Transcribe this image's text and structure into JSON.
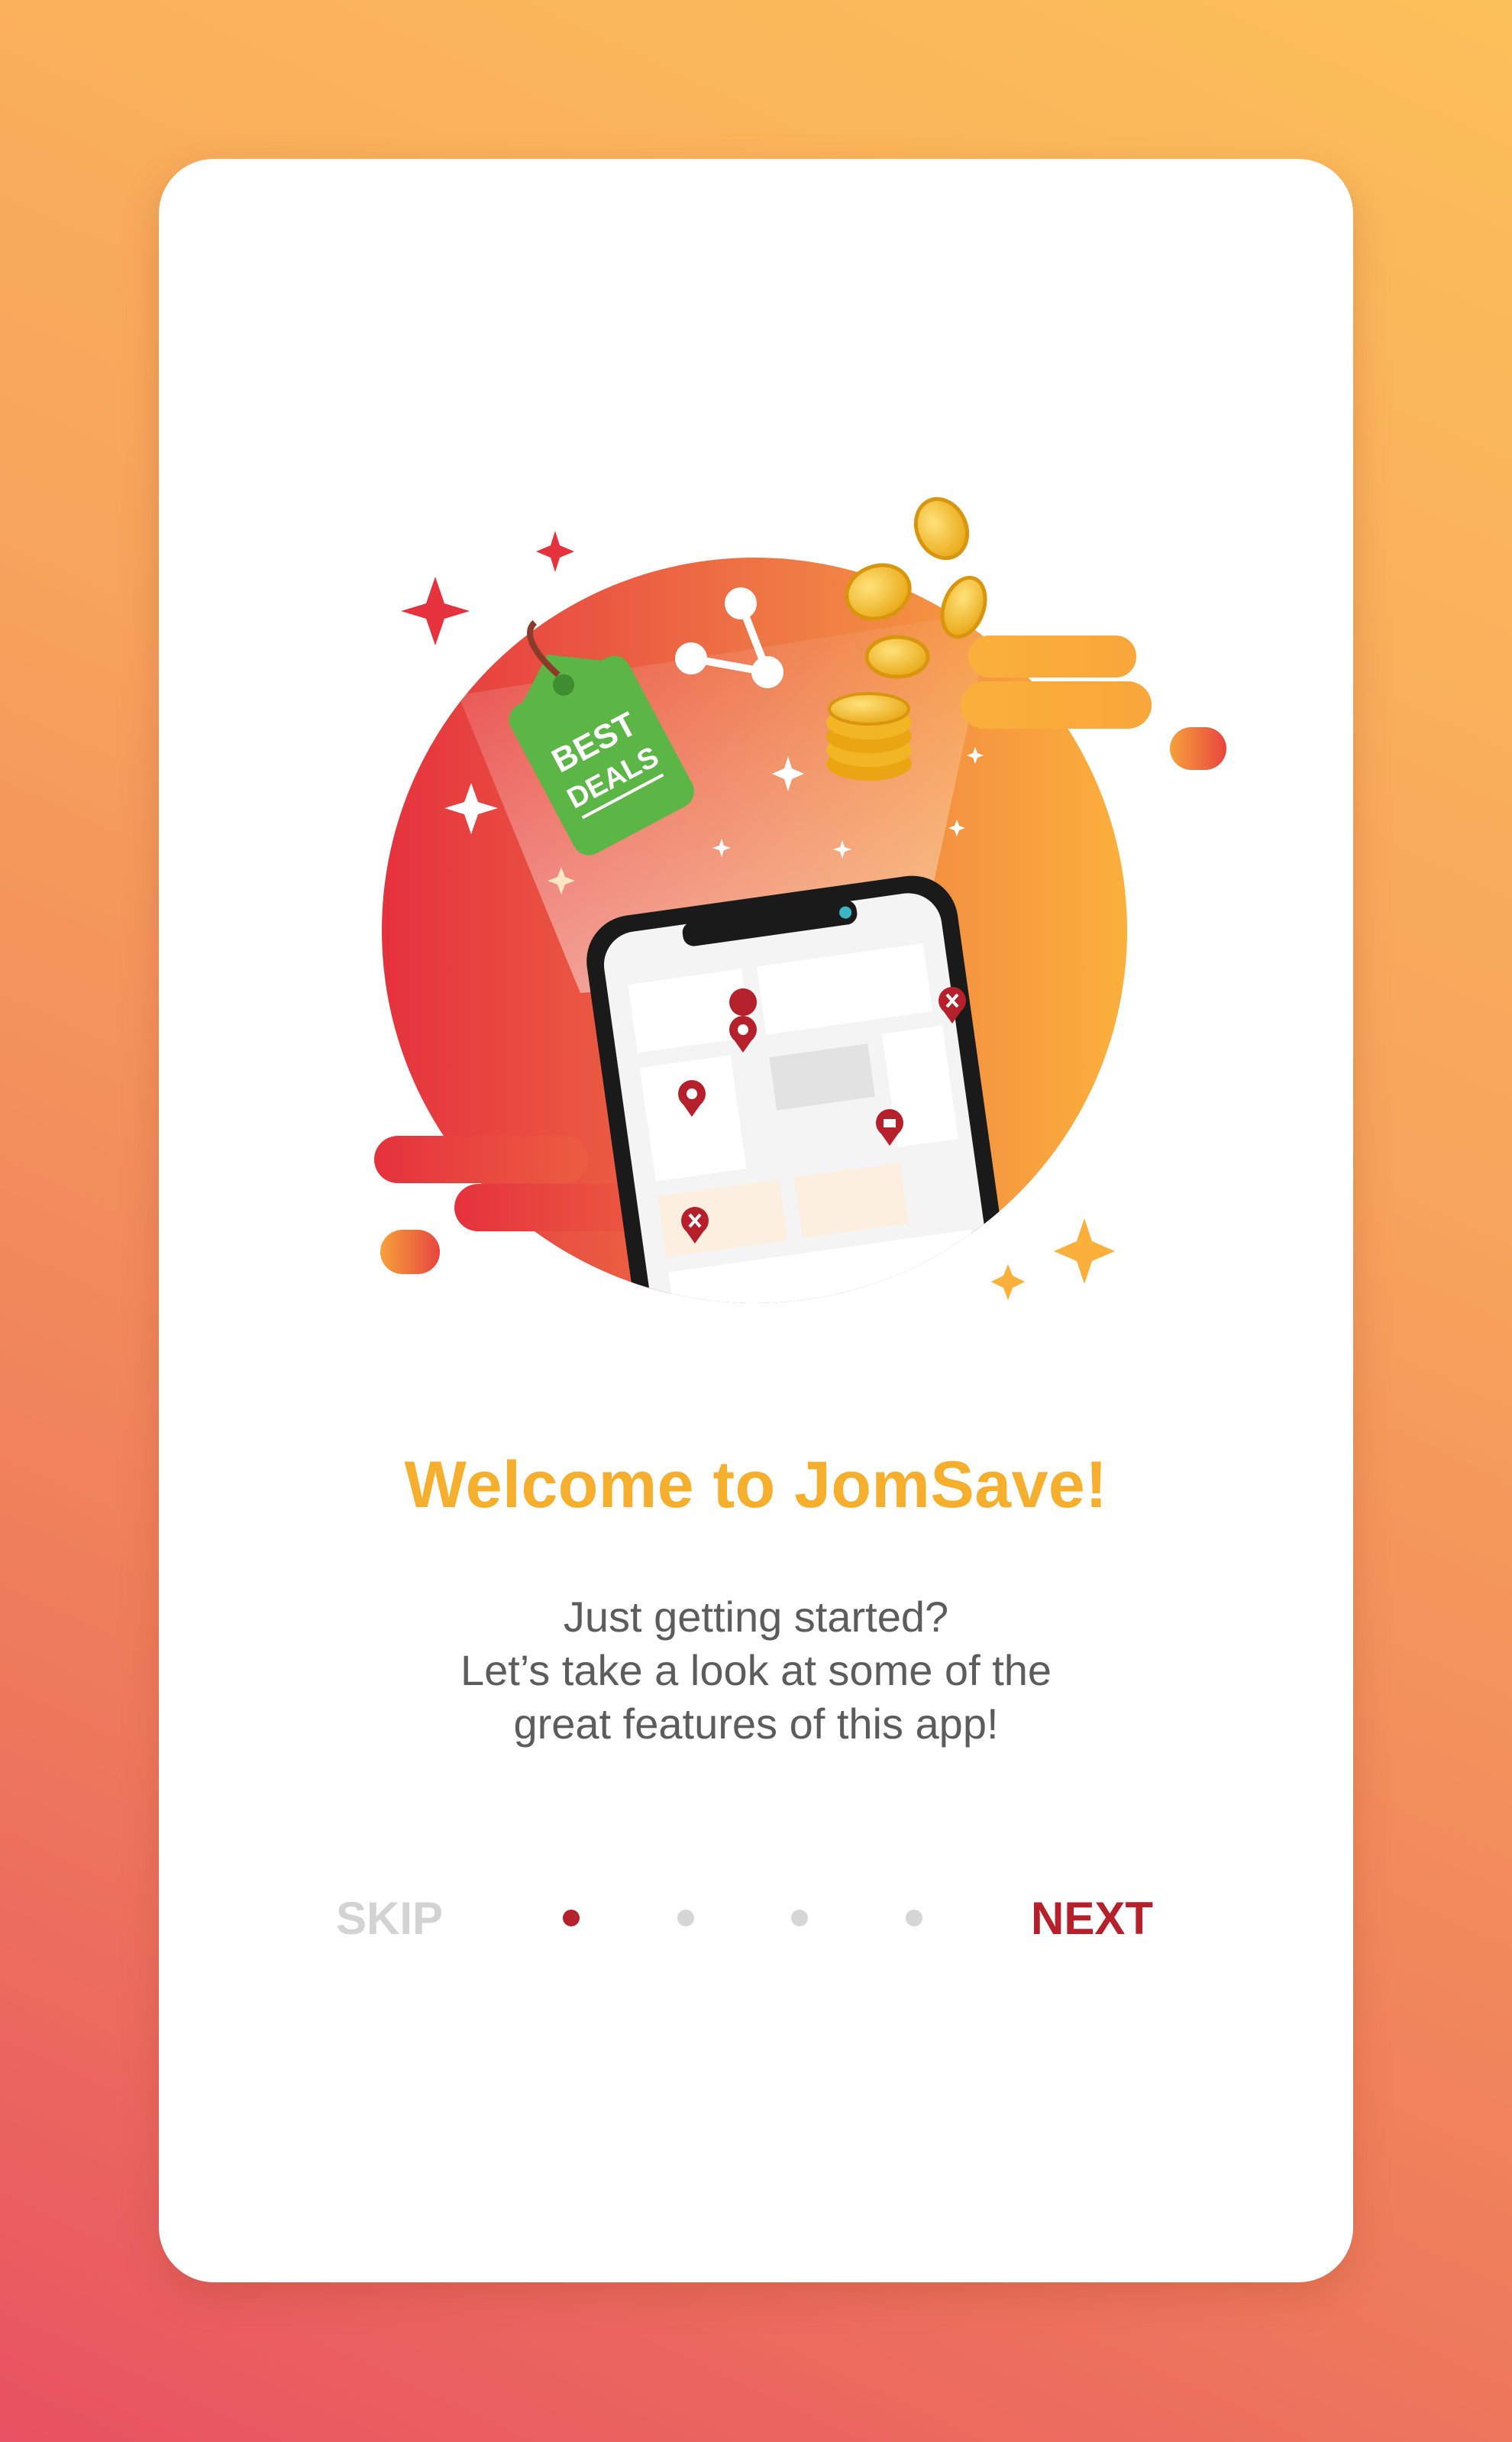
{
  "onboarding": {
    "title": "Welcome to JomSave!",
    "description_lines": [
      "Just getting started?",
      "Let’s take a look at some of the",
      "great features of this app!"
    ],
    "skip_label": "SKIP",
    "next_label": "NEXT",
    "pagination": {
      "total": 4,
      "current": 1
    }
  },
  "illustration": {
    "tag_line1": "BEST",
    "tag_line2": "DEALS",
    "icons": [
      "best-deals-tag-icon",
      "coins-icon",
      "share-icon",
      "smartphone-map-icon",
      "map-pin-icon",
      "sparkle-icon"
    ]
  },
  "colors": {
    "accent_title": "#f6ae2d",
    "accent_next": "#b5202b",
    "skip_gray": "#d3d3d3",
    "tag_green": "#5cb645"
  }
}
